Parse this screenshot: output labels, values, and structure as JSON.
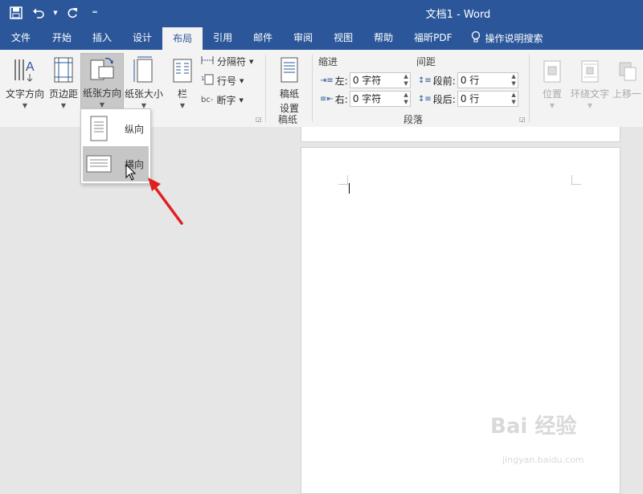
{
  "window": {
    "title": "文档1  -  Word"
  },
  "qat": {
    "save_icon": "save-icon",
    "undo_icon": "undo-icon",
    "redo_icon": "redo-icon",
    "customize_icon": "customize-qat-icon"
  },
  "tabs": [
    {
      "label": "文件"
    },
    {
      "label": "开始"
    },
    {
      "label": "插入"
    },
    {
      "label": "设计"
    },
    {
      "label": "布局"
    },
    {
      "label": "引用"
    },
    {
      "label": "邮件"
    },
    {
      "label": "审阅"
    },
    {
      "label": "视图"
    },
    {
      "label": "帮助"
    },
    {
      "label": "福昕PDF"
    }
  ],
  "active_tab": "布局",
  "tell_me": {
    "label": "操作说明搜索",
    "icon": "lightbulb-icon"
  },
  "ribbon": {
    "text_direction": "文字方向",
    "margins": "页边距",
    "orientation": "纸张方向",
    "size": "纸张大小",
    "columns": "栏",
    "breaks": "分隔符",
    "line_numbers": "行号",
    "hyphenation": "断字",
    "manuscript_line1": "稿纸",
    "manuscript_line2": "设置",
    "manuscript_group": "稿纸",
    "indent_title": "缩进",
    "spacing_title": "间距",
    "indent_left_label": "左:",
    "indent_left_value": "0 字符",
    "indent_right_label": "右:",
    "indent_right_value": "0 字符",
    "space_before_label": "段前:",
    "space_before_value": "0 行",
    "space_after_label": "段后:",
    "space_after_value": "0 行",
    "paragraph_group": "段落",
    "position": "位置",
    "wrap_text": "环绕文字",
    "bring_forward": "上移一"
  },
  "orientation_menu": {
    "portrait": "纵向",
    "landscape": "横向",
    "hovered": "横向"
  },
  "annotation": {
    "arrow_color": "#e02020"
  },
  "colors": {
    "brand": "#2b579a",
    "ribbon_bg": "#f3f3f3",
    "doc_bg": "#e6e6e6"
  },
  "watermark": {
    "main": "Bai 经验",
    "sub": "jingyan.baidu.com"
  }
}
